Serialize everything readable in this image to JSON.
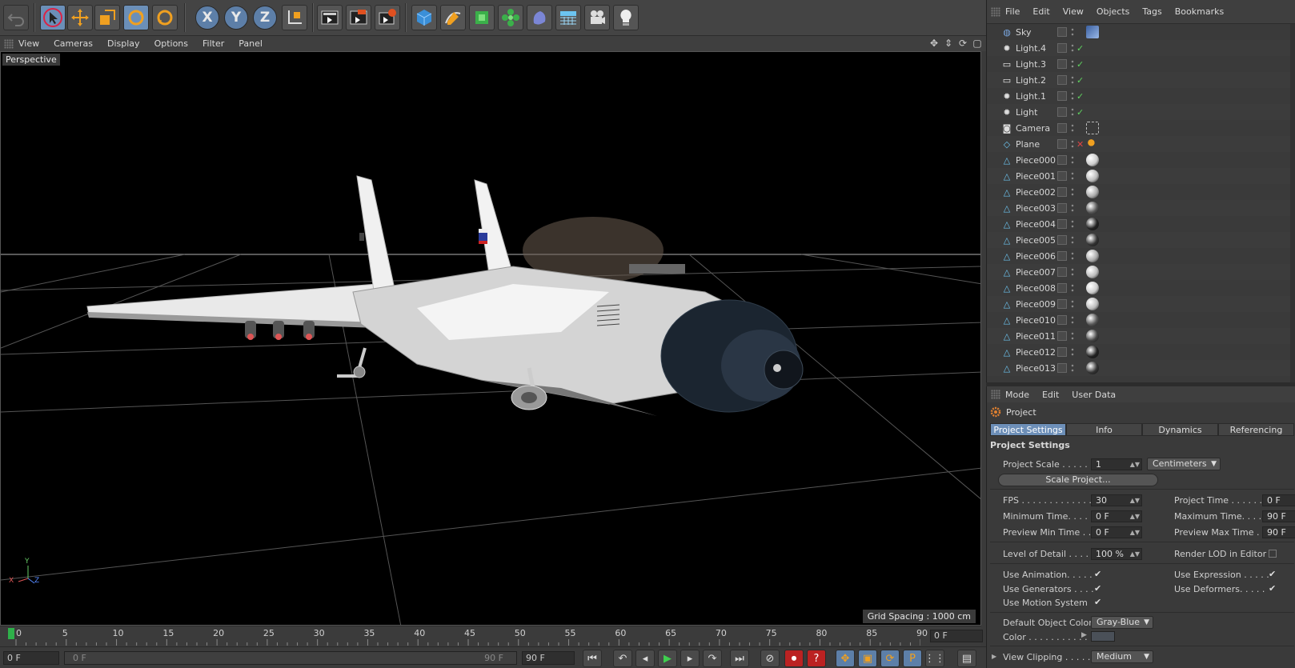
{
  "toolbar": {
    "undo": "undo-icon",
    "tools": [
      "select-arrow-icon",
      "move-icon",
      "scale-icon",
      "rotate-icon",
      "rotate-alt-icon"
    ],
    "axes": [
      "X",
      "Y",
      "Z"
    ],
    "coord": "coordinate-system-icon",
    "render": [
      "render-view-icon",
      "render-picture-viewer-icon",
      "render-settings-icon"
    ],
    "create": [
      "cube-icon",
      "pen-spline-icon",
      "subdivision-icon",
      "cloner-icon",
      "deformer-icon",
      "floor-icon",
      "camera-icon",
      "light-icon"
    ]
  },
  "viewport_menu": [
    "View",
    "Cameras",
    "Display",
    "Options",
    "Filter",
    "Panel"
  ],
  "viewport": {
    "label": "Perspective",
    "grid_spacing": "Grid Spacing : 1000 cm",
    "axis_labels": [
      "Y",
      "X",
      "Z"
    ]
  },
  "timeline": {
    "ticks": [
      "0",
      "5",
      "10",
      "15",
      "20",
      "25",
      "30",
      "35",
      "40",
      "45",
      "50",
      "55",
      "60",
      "65",
      "70",
      "75",
      "80",
      "85",
      "90"
    ],
    "current_frame": "0 F"
  },
  "transport": {
    "start_field": "0 F",
    "range_start": "0 F",
    "range_end": "90 F",
    "end_field": "90 F",
    "buttons": [
      "go-to-start-icon",
      "previous-key-icon",
      "previous-frame-icon",
      "play-icon",
      "next-frame-icon",
      "next-key-icon",
      "go-to-end-icon",
      "motion-record-icon",
      "record-icon",
      "autokey-icon",
      "move-key-icon",
      "scale-key-icon",
      "rotate-key-icon",
      "param-key-icon",
      "pla-key-icon",
      "timeline-icon"
    ]
  },
  "object_manager": {
    "menu": [
      "File",
      "Edit",
      "View",
      "Objects",
      "Tags",
      "Bookmarks"
    ],
    "objects": [
      {
        "name": "Sky",
        "icon": "sky-icon",
        "check": "",
        "tag": "sky-texture"
      },
      {
        "name": "Light.4",
        "icon": "light-icon",
        "check": "✓",
        "tag": ""
      },
      {
        "name": "Light.3",
        "icon": "area-light-icon",
        "check": "✓",
        "tag": ""
      },
      {
        "name": "Light.2",
        "icon": "area-light-icon",
        "check": "✓",
        "tag": ""
      },
      {
        "name": "Light.1",
        "icon": "light-icon",
        "check": "✓",
        "tag": ""
      },
      {
        "name": "Light",
        "icon": "light-icon",
        "check": "✓",
        "tag": ""
      },
      {
        "name": "Camera",
        "icon": "camera-icon",
        "check": "",
        "tag": "target"
      },
      {
        "name": "Plane",
        "icon": "plane-icon",
        "check": "✕",
        "tag": "compositing"
      },
      {
        "name": "Piece000",
        "icon": "polygon-icon",
        "check": "",
        "tag": "material"
      },
      {
        "name": "Piece001",
        "icon": "polygon-icon",
        "check": "",
        "tag": "material"
      },
      {
        "name": "Piece002",
        "icon": "polygon-icon",
        "check": "",
        "tag": "material"
      },
      {
        "name": "Piece003",
        "icon": "polygon-icon",
        "check": "",
        "tag": "material"
      },
      {
        "name": "Piece004",
        "icon": "polygon-icon",
        "check": "",
        "tag": "material"
      },
      {
        "name": "Piece005",
        "icon": "polygon-icon",
        "check": "",
        "tag": "material"
      },
      {
        "name": "Piece006",
        "icon": "polygon-icon",
        "check": "",
        "tag": "material"
      },
      {
        "name": "Piece007",
        "icon": "polygon-icon",
        "check": "",
        "tag": "material"
      },
      {
        "name": "Piece008",
        "icon": "polygon-icon",
        "check": "",
        "tag": "material"
      },
      {
        "name": "Piece009",
        "icon": "polygon-icon",
        "check": "",
        "tag": "material"
      },
      {
        "name": "Piece010",
        "icon": "polygon-icon",
        "check": "",
        "tag": "material"
      },
      {
        "name": "Piece011",
        "icon": "polygon-icon",
        "check": "",
        "tag": "material"
      },
      {
        "name": "Piece012",
        "icon": "polygon-icon",
        "check": "",
        "tag": "material"
      },
      {
        "name": "Piece013",
        "icon": "polygon-icon",
        "check": "",
        "tag": "material"
      }
    ]
  },
  "attribute_manager": {
    "menu": [
      "Mode",
      "Edit",
      "User Data"
    ],
    "title": "Project",
    "tabs": [
      "Project Settings",
      "Info",
      "Dynamics",
      "Referencing"
    ],
    "section": "Project Settings",
    "project_scale_label": "Project Scale . . . . . .",
    "project_scale_value": "1",
    "project_scale_unit": "Centimeters",
    "scale_project_button": "Scale Project...",
    "fps_label": "FPS . . . . . . . . . . . . . .",
    "fps_value": "30",
    "project_time_label": "Project Time . . . . . . .",
    "project_time_value": "0 F",
    "min_time_label": "Minimum Time. . . . .",
    "min_time_value": "0 F",
    "max_time_label": "Maximum Time. . . . .",
    "max_time_value": "90 F",
    "preview_min_label": "Preview Min Time . .",
    "preview_min_value": "0 F",
    "preview_max_label": "Preview Max Time . . .",
    "preview_max_value": "90 F",
    "lod_label": "Level of Detail . . . . .",
    "lod_value": "100 %",
    "render_lod_label": "Render LOD in Editor",
    "use_animation_label": "Use Animation. . . . .",
    "use_expression_label": "Use Expression . . . . .",
    "use_generators_label": "Use Generators . . . .",
    "use_deformers_label": "Use Deformers. . . . .",
    "use_motion_label": "Use Motion System",
    "default_color_label": "Default Object Color",
    "default_color_value": "Gray-Blue",
    "color_label": "Color . . . . . . . . . . .",
    "view_clipping_label": "View Clipping . . . . .",
    "view_clipping_value": "Medium",
    "color_swatch": "#4a5058"
  },
  "colors": {
    "accent_blue": "#6d8fb8",
    "timeline_marker": "#2fb04a",
    "check_green": "#5fd35f",
    "check_red": "#d44"
  }
}
